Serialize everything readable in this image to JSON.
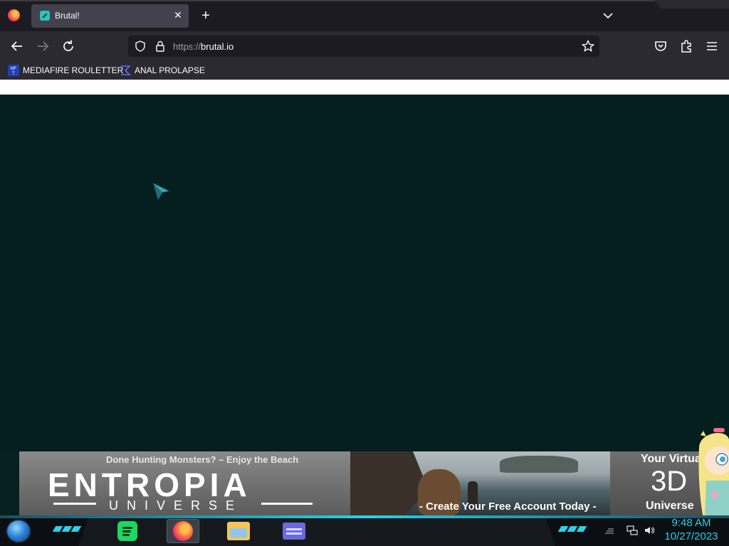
{
  "browser": {
    "tab": {
      "title": "Brutal!"
    },
    "url": {
      "scheme": "https://",
      "host": "brutal.io"
    },
    "bookmarks": [
      {
        "label": "MEDIAFIRE ROULETTER",
        "icon": "mediafire-icon"
      },
      {
        "label": "ANAL PROLAPSE",
        "icon": "sigma-icon"
      }
    ]
  },
  "ad": {
    "tagline": "Done Hunting Monsters? – Enjoy the Beach",
    "brand": "ENTROPIA",
    "brand_sub": "UNIVERSE",
    "cta": "- Create Your Free Account Today -",
    "right_line1": "Your Virtual",
    "right_line2": "3D",
    "right_line3": "Universe"
  },
  "taskbar": {
    "apps": [
      "spotify-icon",
      "firefox-icon",
      "file-explorer-icon",
      "card-app-icon"
    ],
    "active_app": "firefox-icon",
    "clock": {
      "time": "9:48 AM",
      "date": "10/27/2023"
    }
  },
  "colors": {
    "accent": "#2ad1e8",
    "page_background": "#051f21",
    "browser_chrome": "#2b2a33"
  }
}
